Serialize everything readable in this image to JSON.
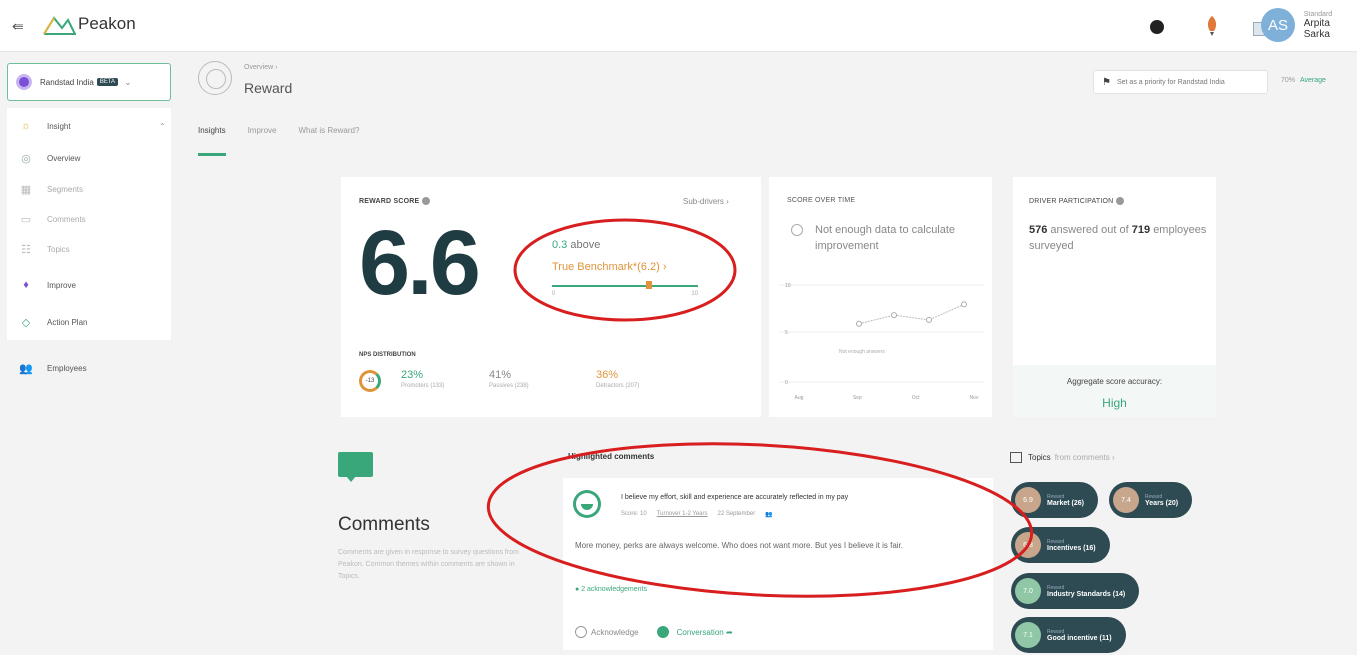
{
  "app": {
    "logo_text": "Peakon"
  },
  "user": {
    "subtitle": "Standard",
    "name": "Arpita Sarka",
    "initials": "AS"
  },
  "sidebar": {
    "company": {
      "name": "Randstad India",
      "badge": "BETA"
    },
    "items": [
      {
        "label": "Insight",
        "icon": "lightbulb-icon"
      },
      {
        "label": "Overview",
        "icon": "gauge-icon"
      },
      {
        "label": "Segments",
        "icon": "grid-icon"
      },
      {
        "label": "Comments",
        "icon": "comment-icon"
      },
      {
        "label": "Topics",
        "icon": "topics-icon"
      },
      {
        "label": "Improve",
        "icon": "improve-icon"
      },
      {
        "label": "Action Plan",
        "icon": "action-plan-icon"
      }
    ],
    "employees": "Employees"
  },
  "header": {
    "breadcrumb": "Overview ›",
    "title": "Reward",
    "tabs": [
      "Insights",
      "Improve",
      "What is Reward?"
    ],
    "priority_label": "Set as a priority for Randstad India",
    "avg_pct": "70%",
    "avg_label": "Average"
  },
  "reward_card": {
    "title": "REWARD SCORE",
    "subdrivers": "Sub-drivers ›",
    "score": "6.6",
    "above_value": "0.3",
    "above_text": "above",
    "benchmark": "True Benchmark*(6.2) ›",
    "bench_low": "0",
    "bench_high": "10",
    "nps_title": "NPS DISTRIBUTION",
    "nps_score": "-13",
    "promoters_pct": "23%",
    "promoters_lbl": "Promoters (133)",
    "passives_pct": "41%",
    "passives_lbl": "Passives (238)",
    "detractors_pct": "36%",
    "detractors_lbl": "Detractors (207)"
  },
  "score_over_time": {
    "title": "SCORE OVER TIME",
    "message": "Not enough data to calculate improvement",
    "chart_note": "Not enough answers",
    "y_ticks": [
      "10",
      "5",
      "0"
    ],
    "x_ticks": [
      "Aug",
      "Sep",
      "Oct",
      "Nov"
    ]
  },
  "driver_participation": {
    "title": "DRIVER PARTICIPATION",
    "answered": "576",
    "answered_text": "answered out of",
    "total": "719",
    "surveyed_text": "employees surveyed",
    "accuracy_label": "Aggregate score accuracy:",
    "accuracy_value": "High"
  },
  "comments": {
    "title": "Comments",
    "description": "Comments are given in response to survey questions from Peakon. Common themes within comments are shown in Topics.",
    "highlighted_title": "Highlighted comments",
    "quote": "I believe my effort, skill and experience are accurately reflected in my pay",
    "meta_score": "Score: 10",
    "meta_link": "Turnover 1-2 Years",
    "meta_date": "22 September",
    "answer": "More money, perks are always welcome. Who does not want more. But yes I believe it is fair.",
    "acknowledged": "2 acknowledgements",
    "acknowledge_btn": "Acknowledge",
    "conversation_btn": "Conversation ➦"
  },
  "topics": {
    "title": "Topics",
    "subtitle": "from comments ›",
    "pills": [
      {
        "score": "6.9",
        "sub": "Reward",
        "name": "Market (26)"
      },
      {
        "score": "7.4",
        "sub": "Reward",
        "name": "Years (20)"
      },
      {
        "score": "6.8",
        "sub": "Reward",
        "name": "Incentives (16)"
      },
      {
        "score": "7.0",
        "sub": "Reward",
        "name": "Industry Standards (14)"
      },
      {
        "score": "7.1",
        "sub": "Reward",
        "name": "Good incentive (11)"
      }
    ]
  },
  "chart_data": {
    "type": "line",
    "title": "SCORE OVER TIME",
    "x": [
      "Aug",
      "Sep",
      "Oct",
      "Nov"
    ],
    "series": [
      {
        "values": [
          6.0,
          6.9,
          6.4,
          8.0
        ]
      }
    ],
    "ylim": [
      0,
      10
    ]
  },
  "colors": {
    "accent": "#3aa77b",
    "orange": "#e0943a",
    "dark": "#1f3c42",
    "annotation": "#d81e1e"
  }
}
